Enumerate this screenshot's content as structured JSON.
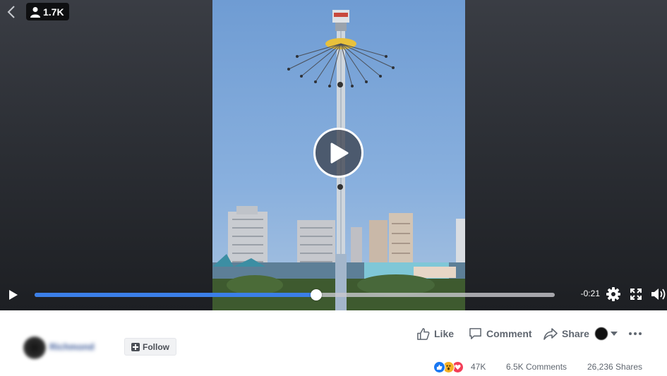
{
  "video": {
    "viewer_count": "1.7K",
    "time_remaining": "-0:21",
    "progress": 0.541
  },
  "post": {
    "author_name": "Richmond",
    "follow_label": "Follow",
    "actions": {
      "like": "Like",
      "comment": "Comment",
      "share": "Share"
    },
    "reaction_count": "47K",
    "comments_count": "6.5K Comments",
    "shares_count": "26,236 Shares"
  },
  "colors": {
    "progress": "#3b7fe8",
    "like_reaction": "#1877f2",
    "love_reaction": "#f33e58",
    "wow_reaction": "#f7b125",
    "author_link": "#3b5998"
  },
  "icons": [
    "back-arrow-icon",
    "person-icon",
    "play-icon",
    "settings-icon",
    "fullscreen-icon",
    "volume-icon",
    "thumbs-up-icon",
    "comment-icon",
    "share-arrow-icon",
    "caret-down-icon",
    "more-dots-icon",
    "follow-plus-icon"
  ]
}
